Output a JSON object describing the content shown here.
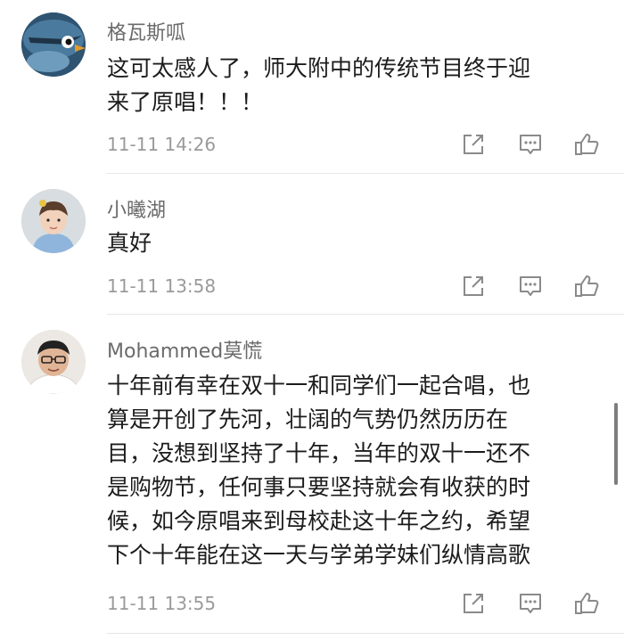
{
  "comments": [
    {
      "username": "格瓦斯呱",
      "content": "这可太感人了，师大附中的传统节目终于迎\n来了原唱！！！",
      "time": "11-11 14:26"
    },
    {
      "username": "小曦湖",
      "content": "真好",
      "time": "11-11 13:58"
    },
    {
      "username": "Mohammed莫慌",
      "content": "十年前有幸在双十一和同学们一起合唱，也\n算是开创了先河，壮阔的气势仍然历历在\n目，没想到坚持了十年，当年的双十一还不\n是购物节，任何事只要坚持就会有收获的时\n候，如今原唱来到母校赴这十年之约，希望\n下个十年能在这一天与学弟学妹们纵情高歌",
      "time": "11-11 13:55"
    }
  ],
  "icons": {
    "share": "share-icon",
    "reply": "comment-icon",
    "like": "thumbs-up-icon"
  },
  "colors": {
    "username": "#6b6b6b",
    "content": "#1c1c1c",
    "time": "#9a9a9a",
    "icon": "#8a8a8a",
    "divider": "#e6e6e6"
  }
}
